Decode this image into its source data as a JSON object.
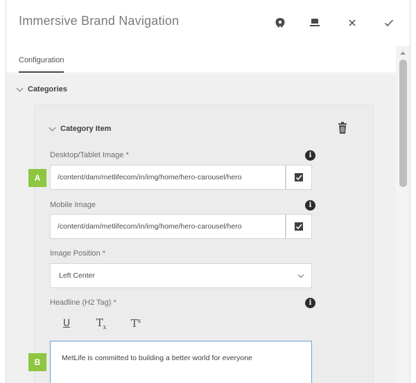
{
  "dialog": {
    "title": "Immersive Brand Navigation",
    "header_icons": [
      "help-icon",
      "fullscreen-icon",
      "close-icon",
      "check-icon"
    ]
  },
  "tabs": [
    {
      "label": "Configuration",
      "active": true
    }
  ],
  "categories": {
    "label": "Categories",
    "item": {
      "label": "Category Item",
      "fields": {
        "desktop_image": {
          "label": "Desktop/Tablet Image *",
          "value": "/content/dam/metlifecom/in/img/home/hero-carousel/hero"
        },
        "mobile_image": {
          "label": "Mobile Image",
          "value": "/content/dam/metlifecom/in/img/home/hero-carousel/hero"
        },
        "image_position": {
          "label": "Image Position *",
          "value": "Left Center"
        },
        "headline": {
          "label": "Headline (H2 Tag) *",
          "toolbar": [
            "U",
            "T",
            "T"
          ],
          "value": "MetLife is committed to building a better world for everyone"
        }
      }
    }
  },
  "annotations": {
    "a": "A",
    "b": "B"
  },
  "colors": {
    "badge": "#8dc63f",
    "focus_border": "#6f9bd9"
  }
}
